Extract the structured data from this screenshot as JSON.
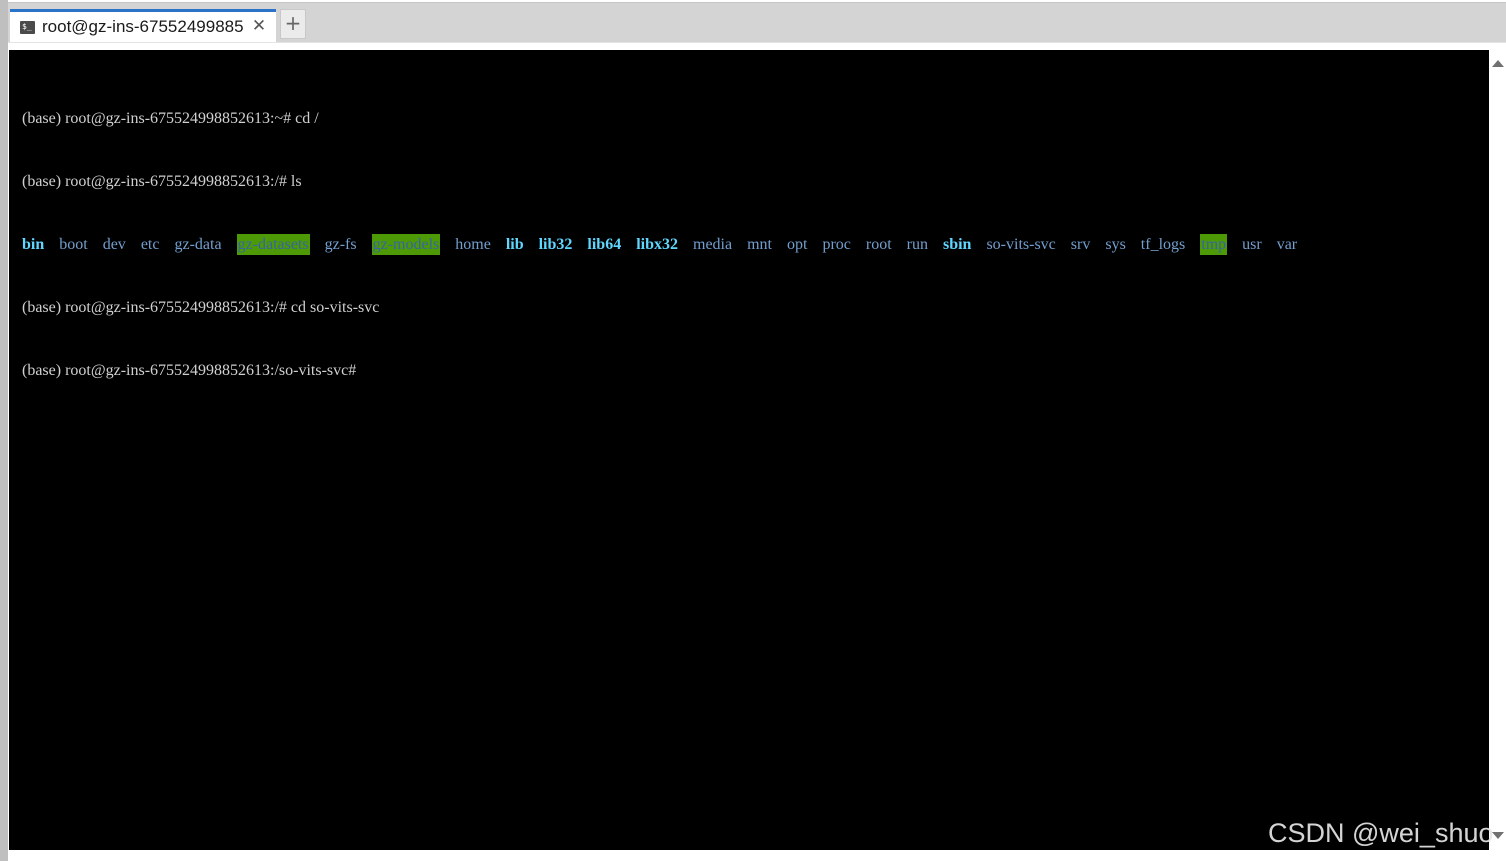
{
  "tab": {
    "title": "root@gz-ins-67552499885",
    "close_glyph": "✕",
    "icon": "terminal-icon"
  },
  "new_tab_label": "+",
  "terminal": {
    "lines": [
      "(base) root@gz-ins-675524998852613:~# cd /",
      "(base) root@gz-ins-675524998852613:/# ls"
    ],
    "ls_entries": [
      {
        "name": "bin",
        "color": "#5fd7ff",
        "bold": true,
        "highlight": false
      },
      {
        "name": "boot",
        "color": "#729fcf",
        "bold": false,
        "highlight": false
      },
      {
        "name": "dev",
        "color": "#729fcf",
        "bold": false,
        "highlight": false
      },
      {
        "name": "etc",
        "color": "#729fcf",
        "bold": false,
        "highlight": false
      },
      {
        "name": "gz-data",
        "color": "#729fcf",
        "bold": false,
        "highlight": false
      },
      {
        "name": "gz-datasets",
        "color": "#3465a4",
        "bold": false,
        "highlight": true
      },
      {
        "name": "gz-fs",
        "color": "#729fcf",
        "bold": false,
        "highlight": false
      },
      {
        "name": "gz-models",
        "color": "#3465a4",
        "bold": false,
        "highlight": true
      },
      {
        "name": "home",
        "color": "#729fcf",
        "bold": false,
        "highlight": false
      },
      {
        "name": "lib",
        "color": "#5fd7ff",
        "bold": true,
        "highlight": false
      },
      {
        "name": "lib32",
        "color": "#5fd7ff",
        "bold": true,
        "highlight": false
      },
      {
        "name": "lib64",
        "color": "#5fd7ff",
        "bold": true,
        "highlight": false
      },
      {
        "name": "libx32",
        "color": "#5fd7ff",
        "bold": true,
        "highlight": false
      },
      {
        "name": "media",
        "color": "#729fcf",
        "bold": false,
        "highlight": false
      },
      {
        "name": "mnt",
        "color": "#729fcf",
        "bold": false,
        "highlight": false
      },
      {
        "name": "opt",
        "color": "#729fcf",
        "bold": false,
        "highlight": false
      },
      {
        "name": "proc",
        "color": "#729fcf",
        "bold": false,
        "highlight": false
      },
      {
        "name": "root",
        "color": "#729fcf",
        "bold": false,
        "highlight": false
      },
      {
        "name": "run",
        "color": "#729fcf",
        "bold": false,
        "highlight": false
      },
      {
        "name": "sbin",
        "color": "#5fd7ff",
        "bold": true,
        "highlight": false
      },
      {
        "name": "so-vits-svc",
        "color": "#729fcf",
        "bold": false,
        "highlight": false
      },
      {
        "name": "srv",
        "color": "#729fcf",
        "bold": false,
        "highlight": false
      },
      {
        "name": "sys",
        "color": "#729fcf",
        "bold": false,
        "highlight": false
      },
      {
        "name": "tf_logs",
        "color": "#729fcf",
        "bold": false,
        "highlight": false
      },
      {
        "name": "tmp",
        "color": "#3465a4",
        "bold": false,
        "highlight": true
      },
      {
        "name": "usr",
        "color": "#729fcf",
        "bold": false,
        "highlight": false
      },
      {
        "name": "var",
        "color": "#729fcf",
        "bold": false,
        "highlight": false
      }
    ],
    "after_lines": [
      "(base) root@gz-ins-675524998852613:/# cd so-vits-svc",
      "(base) root@gz-ins-675524998852613:/so-vits-svc#"
    ]
  },
  "watermark": "CSDN @wei_shuo",
  "colors": {
    "tab_accent": "#2b73c9",
    "terminal_bg": "#000000",
    "terminal_fg": "#d0d0d0",
    "highlight_bg": "#4e9a06"
  }
}
